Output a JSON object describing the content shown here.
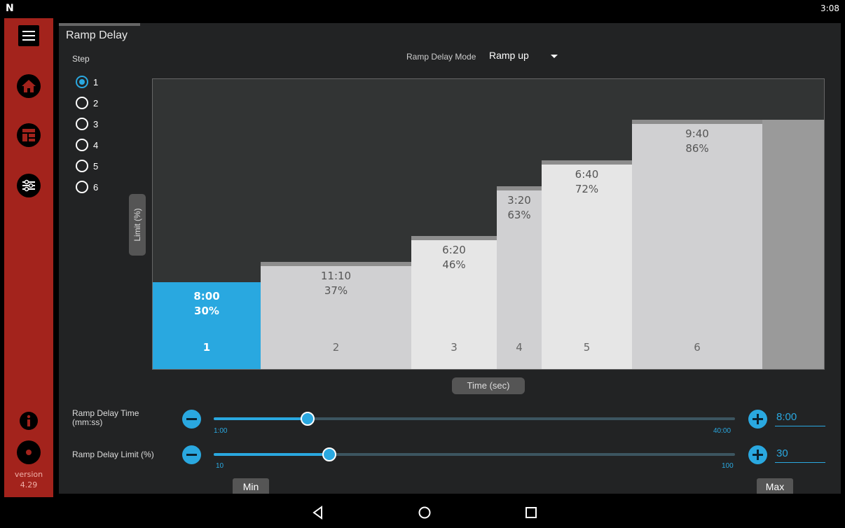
{
  "status_bar": {
    "logo": "N",
    "time": "3:08"
  },
  "sidebar": {
    "version_label": "version",
    "version_number": "4.29"
  },
  "page": {
    "title": "Ramp Delay",
    "step_label": "Step"
  },
  "steps": [
    {
      "label": "1",
      "selected": true
    },
    {
      "label": "2",
      "selected": false
    },
    {
      "label": "3",
      "selected": false
    },
    {
      "label": "4",
      "selected": false
    },
    {
      "label": "5",
      "selected": false
    },
    {
      "label": "6",
      "selected": false
    }
  ],
  "mode": {
    "label": "Ramp Delay Mode",
    "value": "Ramp up"
  },
  "chart_data": {
    "type": "bar",
    "ylabel": "Limit (%)",
    "xlabel": "Time (sec)",
    "ylim": [
      0,
      100
    ],
    "selected_index": 0,
    "bars": [
      {
        "step": "1",
        "time": "8:00",
        "time_seconds": 480,
        "limit": 30,
        "limit_label": "30%"
      },
      {
        "step": "2",
        "time": "11:10",
        "time_seconds": 670,
        "limit": 37,
        "limit_label": "37%"
      },
      {
        "step": "3",
        "time": "6:20",
        "time_seconds": 380,
        "limit": 46,
        "limit_label": "46%"
      },
      {
        "step": "4",
        "time": "3:20",
        "time_seconds": 200,
        "limit": 63,
        "limit_label": "63%"
      },
      {
        "step": "5",
        "time": "6:40",
        "time_seconds": 400,
        "limit": 72,
        "limit_label": "72%"
      },
      {
        "step": "6",
        "time": "9:40",
        "time_seconds": 580,
        "limit": 86,
        "limit_label": "86%"
      }
    ],
    "trailing_limit": 86,
    "colors": {
      "selected": "#29a8e0",
      "light": "#e6e6e6",
      "mid": "#d0d0d2",
      "tail": "#9a9a9a"
    }
  },
  "sliders": {
    "time": {
      "label_line1": "Ramp Delay Time",
      "label_line2": "(mm:ss)",
      "min_label": "1:00",
      "max_label": "40:00",
      "min": 60,
      "max": 2400,
      "value": 480,
      "value_text": "8:00"
    },
    "limit": {
      "label": "Ramp Delay Limit (%)",
      "min_label": "10",
      "max_label": "100",
      "min": 10,
      "max": 100,
      "value": 30,
      "value_text": "30"
    }
  },
  "buttons": {
    "min": "Min",
    "max": "Max"
  },
  "colors": {
    "accent": "#2aa8e0",
    "sidebar": "#a3231c",
    "panel": "#222324"
  }
}
